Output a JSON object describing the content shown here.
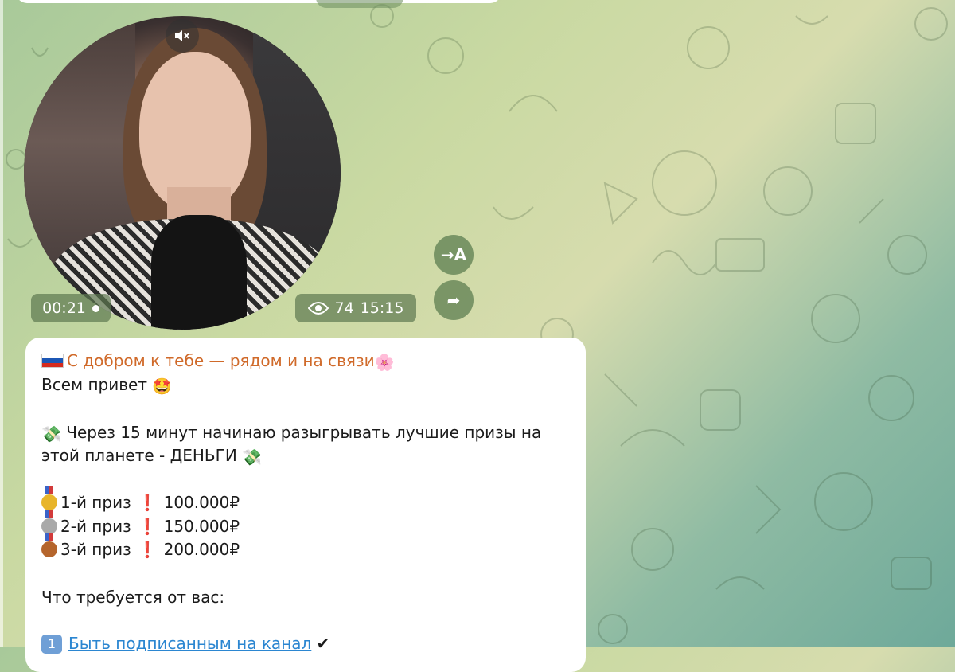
{
  "video": {
    "duration": "00:21",
    "views": "74",
    "time": "15:15"
  },
  "buttons": {
    "translate_label": "→A",
    "forward_label": "➦"
  },
  "message": {
    "title": "С добром к тебе — рядом и на связи",
    "title_end_emoji": "🌸",
    "greeting": "Всем привет",
    "greeting_emoji": "🤩",
    "money_emoji": "💸",
    "line1": " Через 15 минут начинаю разыгрывать лучшие призы на",
    "line2": "этой планете - ДЕНЬГИ ",
    "prizes": [
      {
        "label": "1-й приз",
        "amount": "100.000₽",
        "color": "#e8b52a"
      },
      {
        "label": "2-й приз",
        "amount": "150.000₽",
        "color": "#a9a9a9"
      },
      {
        "label": "3-й приз",
        "amount": "200.000₽",
        "color": "#b5652c"
      }
    ],
    "exclaim": "❗",
    "requirements_header": "Что требуется от вас:",
    "requirement1_number": "1",
    "requirement1_link": "Быть подписанным на канал",
    "requirement1_check": "✔"
  },
  "colors": {
    "title": "#d06a2a",
    "link": "#2b86d1",
    "bubble": "#ffffff"
  }
}
